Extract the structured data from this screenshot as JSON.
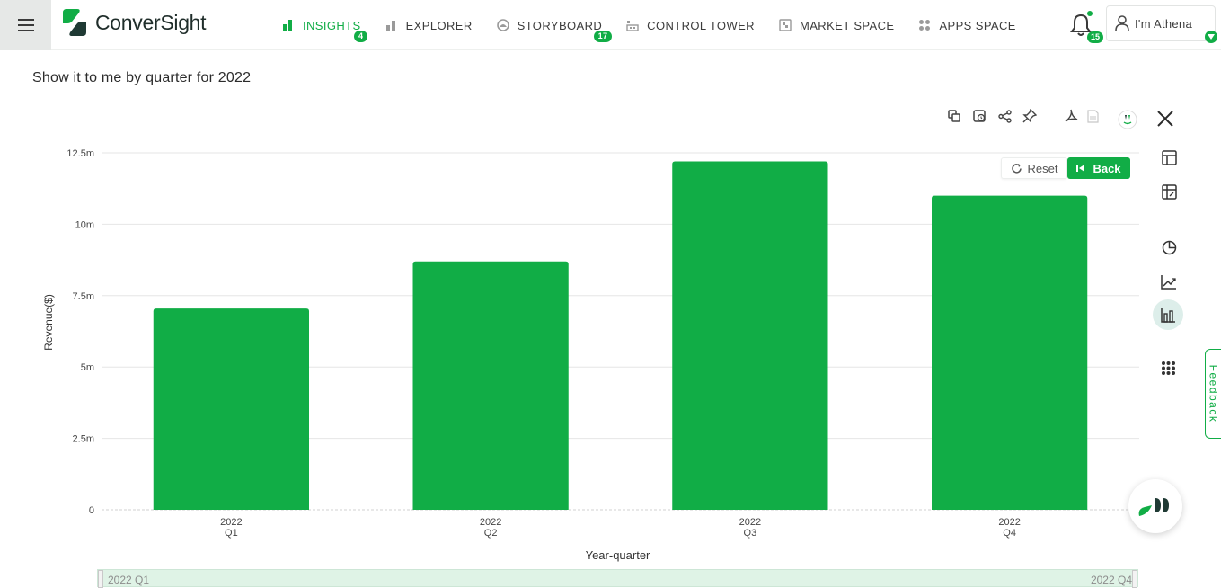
{
  "app": {
    "name": "ConverSight"
  },
  "nav": {
    "items": [
      {
        "label": "INSIGHTS",
        "badge": "4",
        "active": true,
        "icon": "insights-icon"
      },
      {
        "label": "EXPLORER",
        "badge": "",
        "active": false,
        "icon": "explorer-icon"
      },
      {
        "label": "STORYBOARD",
        "badge": "17",
        "active": false,
        "icon": "storyboard-icon"
      },
      {
        "label": "CONTROL TOWER",
        "badge": "",
        "active": false,
        "icon": "control-tower-icon"
      },
      {
        "label": "MARKET SPACE",
        "badge": "",
        "active": false,
        "icon": "market-space-icon"
      },
      {
        "label": "APPS SPACE",
        "badge": "",
        "active": false,
        "icon": "apps-space-icon"
      }
    ],
    "notifications_count": "15",
    "user_label": "I'm Athena"
  },
  "query": "Show it to me by quarter for 2022",
  "chart_controls": {
    "reset_label": "Reset",
    "back_label": "Back"
  },
  "feedback_label": "Feedback",
  "range_slider": {
    "start_label": "2022 Q1",
    "end_label": "2022 Q4"
  },
  "colors": {
    "accent": "#11ad46",
    "bar": "#11ad46"
  },
  "chart_data": {
    "type": "bar",
    "categories": [
      [
        "2022",
        "Q1"
      ],
      [
        "2022",
        "Q2"
      ],
      [
        "2022",
        "Q3"
      ],
      [
        "2022",
        "Q4"
      ]
    ],
    "values": [
      7.05,
      8.7,
      12.2,
      11.0
    ],
    "value_unit": "m",
    "ylim": [
      0,
      12.5
    ],
    "yticks": [
      0,
      2.5,
      5,
      7.5,
      10,
      12.5
    ],
    "ytick_labels": [
      "0",
      "2.5m",
      "5m",
      "7.5m",
      "10m",
      "12.5m"
    ],
    "xlabel": "Year-quarter",
    "ylabel": "Revenue($)",
    "grid": true
  }
}
